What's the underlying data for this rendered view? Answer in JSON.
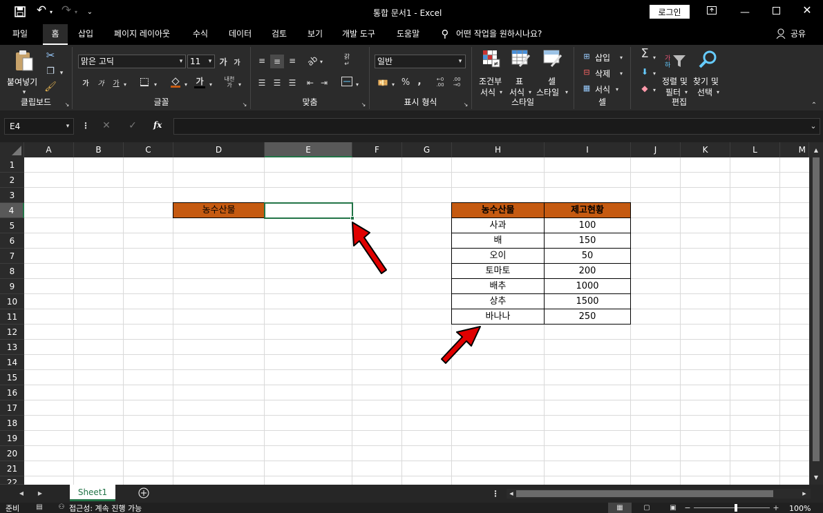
{
  "window": {
    "title": "통합 문서1  -  Excel",
    "login_label": "로그인"
  },
  "tabs": [
    "파일",
    "홈",
    "삽입",
    "페이지 레이아웃",
    "수식",
    "데이터",
    "검토",
    "보기",
    "개발 도구",
    "도움말"
  ],
  "tell_me": "어떤 작업을 원하시나요?",
  "share": "공유",
  "ribbon": {
    "paste": "붙여넣기",
    "clipboard": "클립보드",
    "font_name": "맑은 고딕",
    "font_size": "11",
    "font_group": "글꼴",
    "align_group": "맞춤",
    "number_format": "일반",
    "number_group": "표시 형식",
    "cond_format_1": "조건부",
    "cond_format_2": "서식",
    "table_fmt_1": "표",
    "table_fmt_2": "서식",
    "cell_style_1": "셀",
    "cell_style_2": "스타일",
    "styles_group": "스타일",
    "insert": "삽입",
    "delete": "삭제",
    "format": "서식",
    "cells_group": "셀",
    "sort_1": "정렬 및",
    "sort_2": "필터",
    "find_1": "찾기 및",
    "find_2": "선택",
    "edit_group": "편집"
  },
  "formula_bar": {
    "name_box": "E4",
    "fx": "fx",
    "value": ""
  },
  "columns": [
    "A",
    "B",
    "C",
    "D",
    "E",
    "F",
    "G",
    "H",
    "I",
    "J",
    "K",
    "L",
    "M"
  ],
  "rows": [
    "1",
    "2",
    "3",
    "4",
    "5",
    "6",
    "7",
    "8",
    "9",
    "10",
    "11",
    "12",
    "13",
    "14",
    "15",
    "16",
    "17",
    "18",
    "19",
    "20",
    "21",
    "22"
  ],
  "cells": {
    "d4": "농수산물",
    "e4": ""
  },
  "table": {
    "headers": [
      "농수산물",
      "제고현황"
    ],
    "rows": [
      [
        "사과",
        "100"
      ],
      [
        "배",
        "150"
      ],
      [
        "오이",
        "50"
      ],
      [
        "토마토",
        "200"
      ],
      [
        "배추",
        "1000"
      ],
      [
        "상추",
        "1500"
      ],
      [
        "바나나",
        "250"
      ]
    ]
  },
  "sheet_tab": "Sheet1",
  "status": {
    "ready": "준비",
    "accessibility": "접근성: 계속 진행 가능",
    "zoom": "100%"
  },
  "colors": {
    "accent": "#217346",
    "header_fill": "#c55a11",
    "arrow": "#e00000"
  }
}
